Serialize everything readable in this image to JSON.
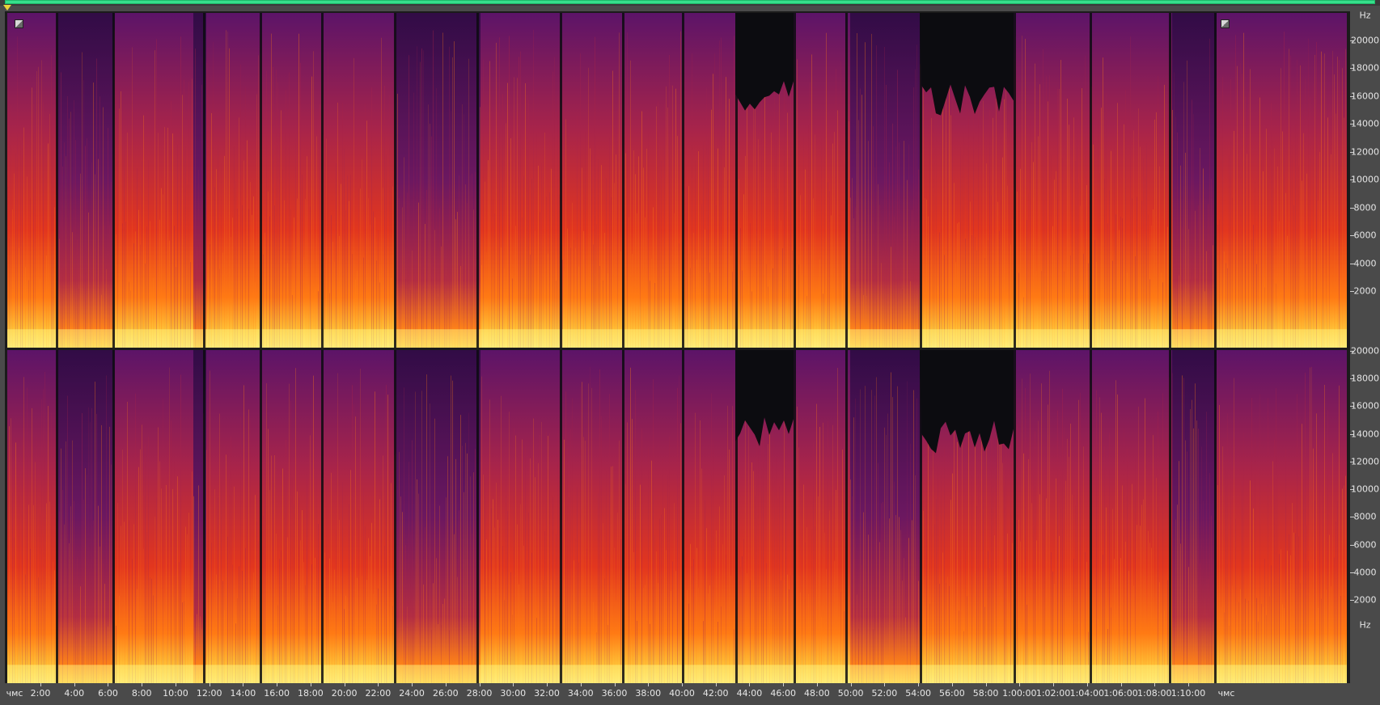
{
  "time_axis": {
    "start_label": "чмс",
    "end_label": "чмс",
    "ticks": [
      "2:00",
      "4:00",
      "6:00",
      "8:00",
      "10:00",
      "12:00",
      "14:00",
      "16:00",
      "18:00",
      "20:00",
      "22:00",
      "24:00",
      "26:00",
      "28:00",
      "30:00",
      "32:00",
      "34:00",
      "36:00",
      "38:00",
      "40:00",
      "42:00",
      "44:00",
      "46:00",
      "48:00",
      "50:00",
      "52:00",
      "54:00",
      "56:00",
      "58:00",
      "1:00:00",
      "1:02:00",
      "1:04:00",
      "1:06:00",
      "1:08:00",
      "1:10:00"
    ]
  },
  "freq_axis": {
    "unit": "Hz",
    "ticks": [
      "20000",
      "18000",
      "16000",
      "14000",
      "12000",
      "10000",
      "8000",
      "6000",
      "4000",
      "2000"
    ]
  },
  "channels": [
    "left",
    "right"
  ],
  "colors": {
    "overview_bar": "#36e08c",
    "playhead": "#e8d23a",
    "colormap": [
      "#0c0c10",
      "#2a0a40",
      "#5c1468",
      "#a8244a",
      "#e2361e",
      "#ff7a14",
      "#ffc83a",
      "#fff07a"
    ]
  }
}
